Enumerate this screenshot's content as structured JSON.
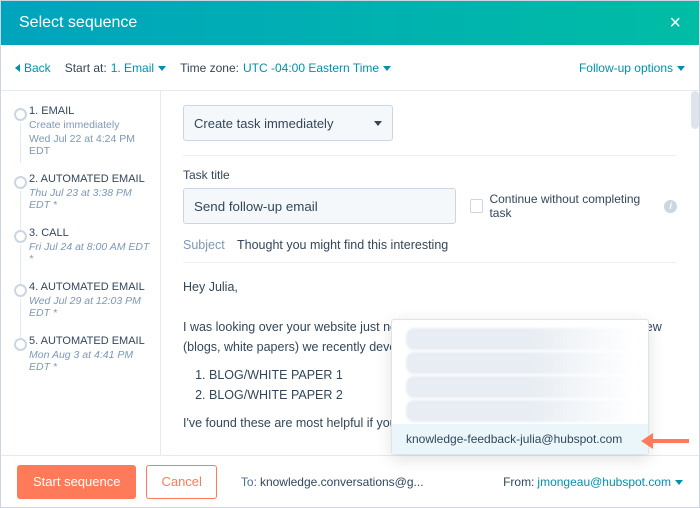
{
  "header": {
    "title": "Select sequence"
  },
  "toolbar": {
    "back": "Back",
    "start_at_label": "Start at:",
    "start_at_value": "1. Email",
    "tz_label": "Time zone:",
    "tz_value": "UTC -04:00 Eastern Time",
    "followup": "Follow-up options"
  },
  "sidebar": {
    "steps": [
      {
        "title": "1. EMAIL",
        "sub": "Create immediately",
        "sub2": "Wed Jul 22 at 4:24 PM EDT"
      },
      {
        "title": "2. AUTOMATED EMAIL",
        "sub": "Thu Jul 23 at 3:38 PM EDT *",
        "sub2": ""
      },
      {
        "title": "3. CALL",
        "sub": "Fri Jul 24 at 8:00 AM EDT *",
        "sub2": ""
      },
      {
        "title": "4. AUTOMATED EMAIL",
        "sub": "Wed Jul 29 at 12:03 PM EDT *",
        "sub2": ""
      },
      {
        "title": "5. AUTOMATED EMAIL",
        "sub": "Mon Aug 3 at 4:41 PM EDT *",
        "sub2": ""
      }
    ]
  },
  "content": {
    "create_task_dropdown": "Create task immediately",
    "task_title_label": "Task title",
    "task_title_value": "Send follow-up email",
    "continue_checkbox": "Continue without completing task",
    "subject_label": "Subject",
    "subject_value": "Thought you might find this interesting",
    "body_greeting": "Hey Julia,",
    "body_p1": " I was looking over your website just now and thought you might enjoy some of the new (blogs, white papers) we recently developed for folks just like you:",
    "body_li1": "BLOG/WHITE PAPER 1",
    "body_li2": "BLOG/WHITE PAPER 2",
    "body_p2": "I've found these are most helpful if you're e"
  },
  "popup": {
    "highlight": "knowledge-feedback-julia@hubspot.com"
  },
  "footer": {
    "start": "Start sequence",
    "cancel": "Cancel",
    "to_label": "To:",
    "to_value": "knowledge.conversations@g...",
    "from_label": "From:",
    "from_value": "jmongeau@hubspot.com"
  }
}
